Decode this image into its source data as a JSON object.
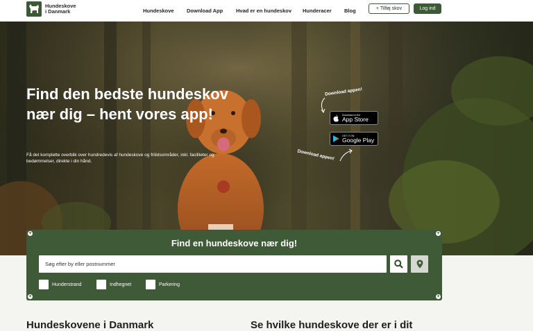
{
  "header": {
    "logo_line1": "Hundeskove",
    "logo_line2": "i Danmark",
    "nav": [
      "Hundeskove",
      "Download App",
      "Hvad er en hundeskov",
      "Hunderacer",
      "Blog"
    ],
    "add_button": "+ Tilføj skov",
    "login_button": "Log ind"
  },
  "hero": {
    "title": "Find den bedste hundeskov nær dig – hent vores app!",
    "subtitle": "Få det komplette overblik over hundredevis af hundeskove og fritidsområder, inkl. faciliteter og bedømmelser, direkte i din hånd.",
    "download_label_top": "Download appen!",
    "download_label_bottom": "Download appen!",
    "app_store_small": "Download on the",
    "app_store_big": "App Store",
    "google_play_small": "GET IT ON",
    "google_play_big": "Google Play"
  },
  "search": {
    "title": "Find en hundeskove nær dig!",
    "placeholder": "Søg efter by eller postnummer",
    "filters": [
      "Hunderstrand",
      "Indhegnet",
      "Parkering"
    ]
  },
  "sections": {
    "left_heading": "Hundeskovene i Danmark",
    "right_heading": "Se hvilke hundeskove der er i dit"
  },
  "colors": {
    "brand_green": "#3e5a36",
    "header_bg": "#ffffff"
  }
}
